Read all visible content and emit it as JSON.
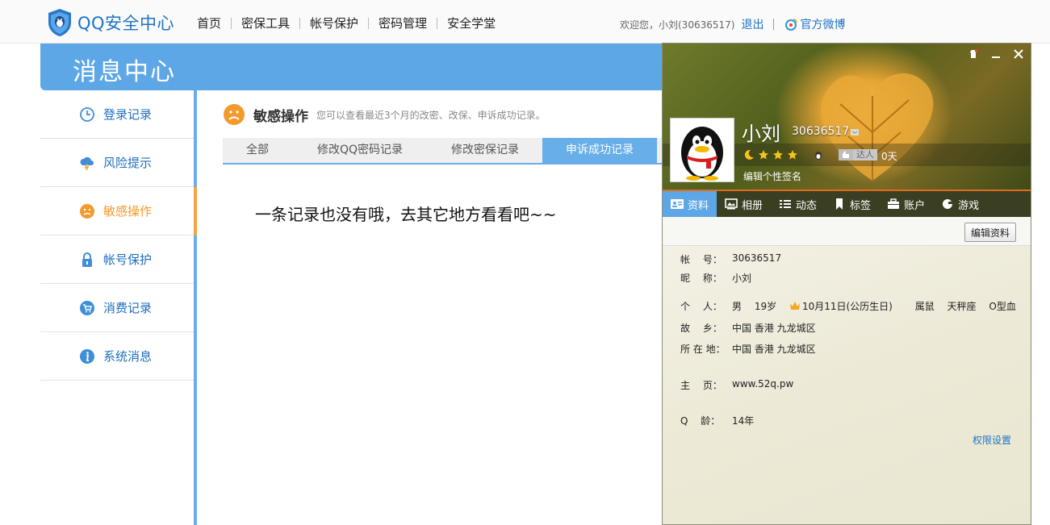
{
  "header": {
    "logo_text": "QQ安全中心",
    "nav": [
      "首页",
      "密保工具",
      "帐号保护",
      "密码管理",
      "安全学堂"
    ],
    "welcome": "欢迎您，小刘(30636517)",
    "logout": "退出",
    "weibo": "官方微博"
  },
  "banner": {
    "title": "消息中心"
  },
  "sidebar": {
    "items": [
      {
        "label": "登录记录",
        "icon": "clock-icon"
      },
      {
        "label": "风险提示",
        "icon": "cloud-lightning-icon"
      },
      {
        "label": "敏感操作",
        "icon": "face-icon",
        "active": true
      },
      {
        "label": "帐号保护",
        "icon": "lock-icon"
      },
      {
        "label": "消费记录",
        "icon": "cart-icon"
      },
      {
        "label": "系统消息",
        "icon": "info-icon"
      }
    ]
  },
  "main": {
    "title": "敏感操作",
    "subtitle": "您可以查看最近3个月的改密、改保、申诉成功记录。",
    "tabs": [
      "全部",
      "修改QQ密码记录",
      "修改密保记录",
      "申诉成功记录"
    ],
    "active_tab": 3,
    "empty_message": "一条记录也没有哦，去其它地方看看吧~~"
  },
  "profile": {
    "nickname": "小刘",
    "qq_number": "30636517",
    "days": "0天",
    "talent": "达人",
    "signature": "编辑个性签名",
    "tabs": [
      "资料",
      "相册",
      "动态",
      "标签",
      "账户",
      "游戏"
    ],
    "active_tab": 0,
    "edit_button": "编辑资料",
    "fields": {
      "account_label": "帐　 号：",
      "account": "30636517",
      "nick_label": "昵　 称：",
      "nick": "小刘",
      "personal_label": "个　 人：",
      "gender": "男",
      "age": "19岁",
      "birthday": "10月11日(公历生日)",
      "zodiac": "属鼠",
      "constellation": "天秤座",
      "blood": "O型血",
      "hometown_label": "故　 乡：",
      "hometown": "中国 香港 九龙城区",
      "location_label": "所 在 地：",
      "location": "中国 香港 九龙城区",
      "homepage_label": "主　 页：",
      "homepage": "www.52q.pw",
      "qage_label": "Q　 龄：",
      "qage": "14年"
    },
    "permission_link": "权限设置"
  },
  "colors": {
    "accent_blue": "#5ea7e6",
    "link_blue": "#1e73c4",
    "active_orange": "#f39a2c"
  }
}
